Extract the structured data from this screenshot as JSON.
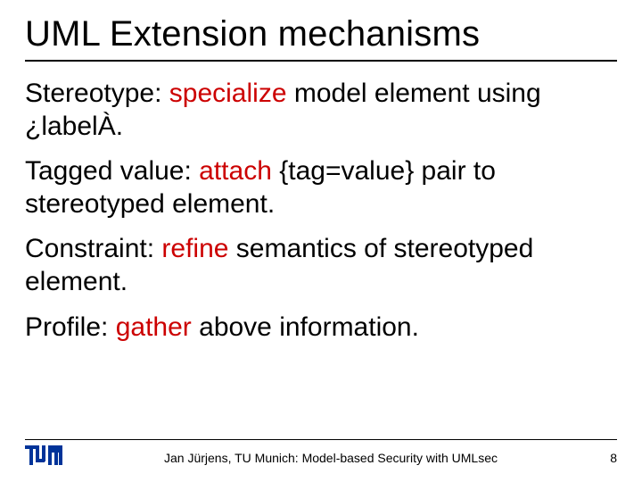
{
  "title": "UML Extension mechanisms",
  "bullets": {
    "b1": {
      "pre": "Stereotype: ",
      "kw": "specialize",
      "post": " model element using ¿labelÀ."
    },
    "b2": {
      "pre": "Tagged value: ",
      "kw": "attach",
      "post": " {tag=value} pair to stereotyped element."
    },
    "b3": {
      "pre": "Constraint: ",
      "kw": "refine",
      "post": " semantics of stereotyped element."
    },
    "b4": {
      "pre": "Profile: ",
      "kw": "gather",
      "post": " above information."
    }
  },
  "footer": {
    "text": "Jan Jürjens, TU Munich: Model-based Security with UMLsec",
    "page": "8"
  }
}
